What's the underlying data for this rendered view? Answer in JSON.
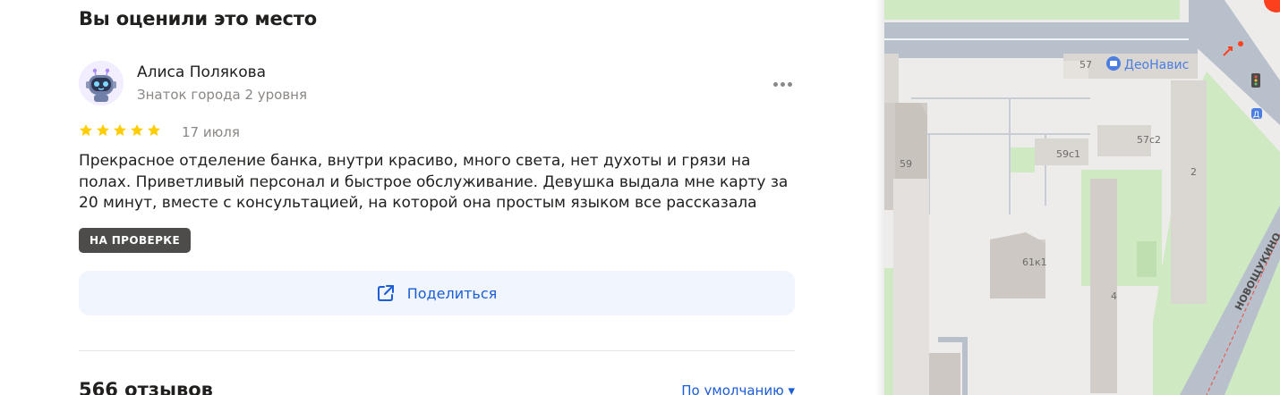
{
  "section_title": "Вы оценили это место",
  "review": {
    "author_name": "Алиса Полякова",
    "author_level": "Знаток города 2 уровня",
    "rating": 5,
    "date": "17 июля",
    "text": "Прекрасное отделение банка, внутри красиво, много света, нет духоты и грязи на полах. Приветливый персонал и быстрое обслуживание. Девушка выдала мне карту за 20 минут, вместе с консультацией, на которой она простым языком все рассказала",
    "status": "НА ПРОВЕРКЕ",
    "share_label": "Поделиться",
    "icons": {
      "avatar": "robot-avatar-icon",
      "more": "more-dots-icon",
      "star": "star-icon",
      "share": "share-icon"
    }
  },
  "reviews_summary": {
    "count_label": "566 отзывов",
    "sort_label": "По умолчанию ▾"
  },
  "map": {
    "poi_name": "ДеоНавис",
    "street_name": "НОВОЩУКИНО",
    "building_labels": [
      "57",
      "57с2",
      "59с1",
      "59",
      "2",
      "61к1",
      "4"
    ],
    "colors": {
      "road": "#b8c0cc",
      "park": "#cfe9c3",
      "building": "#dad6d2",
      "poi": "#4a7ee0",
      "accent": "#fc3f1d"
    }
  },
  "colors": {
    "link": "#1a5dd6",
    "star": "#ffcc00",
    "badge": "#4d4c4a",
    "share_bg": "#f1f5fd"
  }
}
